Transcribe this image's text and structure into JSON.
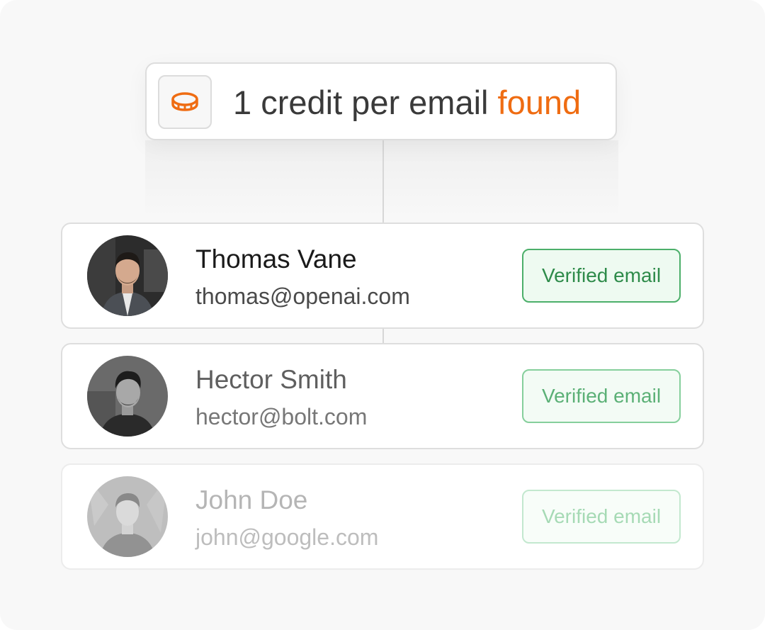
{
  "header": {
    "text_main": "1 credit per email ",
    "text_accent": "found",
    "accent_color": "#ef6c12",
    "icon": "coin-icon"
  },
  "people": [
    {
      "name": "Thomas Vane",
      "email": "thomas@openai.com",
      "badge": "Verified email",
      "avatar": "avatar-photo"
    },
    {
      "name": "Hector Smith",
      "email": "hector@bolt.com",
      "badge": "Verified email",
      "avatar": "avatar-photo"
    },
    {
      "name": "John Doe",
      "email": "john@google.com",
      "badge": "Verified email",
      "avatar": "avatar-photo"
    }
  ],
  "colors": {
    "badge_green": "#2e8b4a",
    "badge_bg": "#eefaf1",
    "panel_bg": "#f8f8f8"
  }
}
